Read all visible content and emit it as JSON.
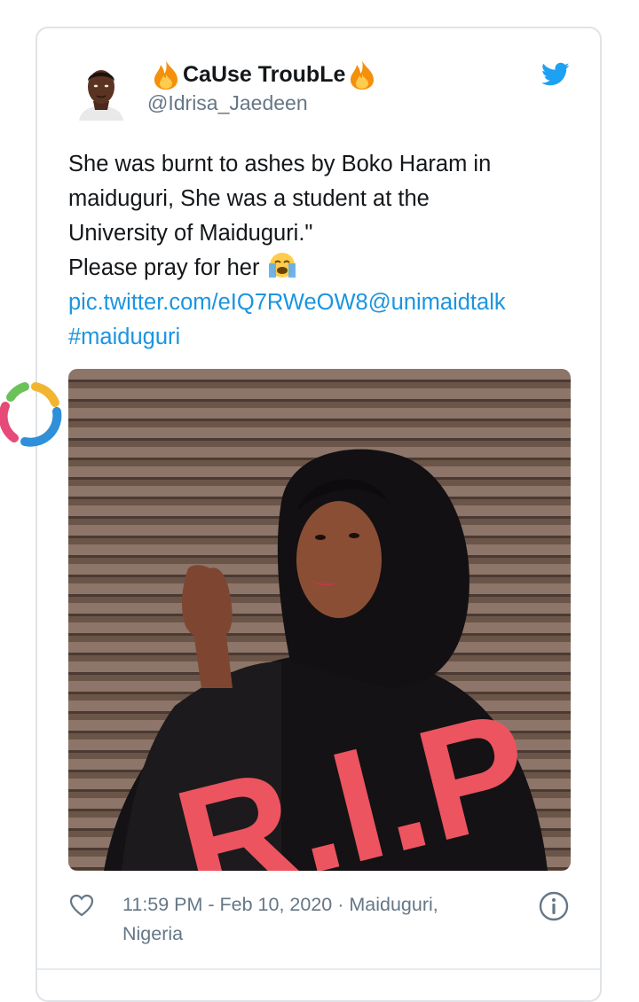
{
  "tweet": {
    "display_name": "CaUse TroubLe",
    "handle": "@Idrisa_Jaedeen",
    "text_lines": [
      "She was burnt to ashes by Boko Haram in",
      "maiduguri, She was a student at the",
      "University of Maiduguri.\"",
      "Please pray for her"
    ],
    "link": "pic.twitter.com/eIQ7RWeOW8",
    "mention": "@unimaidtalk",
    "hashtag": "#maiduguri",
    "photo_caption": "R.I.P",
    "timestamp": "11:59 PM - Feb 10, 2020 · Maiduguri,",
    "location_line2": "Nigeria"
  },
  "icons": {
    "name_emoji": "fire-icon",
    "text_emoji": "loudly-crying-face-icon",
    "brand": "twitter-bird-icon",
    "like": "heart-icon",
    "info": "info-icon"
  },
  "colors": {
    "link": "#1b95e0",
    "twitter_blue": "#1da1f2",
    "secondary_text": "#657786",
    "caption_red": "#ec5460"
  }
}
